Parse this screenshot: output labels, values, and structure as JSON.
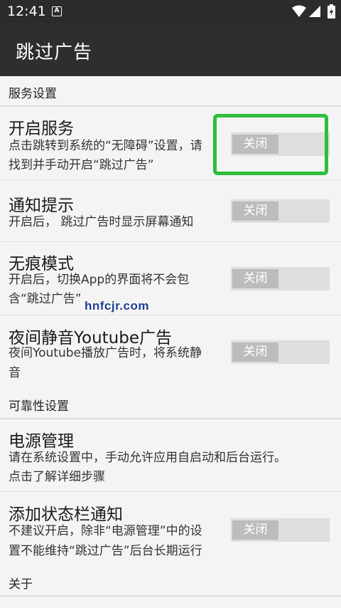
{
  "status_bar": {
    "time": "12:41",
    "notification_letter": "A"
  },
  "app_bar": {
    "title": "跳过广告"
  },
  "sections": {
    "service": "服务设置",
    "reliability": "可靠性设置",
    "about": "关于"
  },
  "items": {
    "start_service": {
      "title": "开启服务",
      "desc_line1": "点击跳转到系统的“无障碍”设置，请",
      "desc_line2": "找到并手动开启“跳过广告”",
      "toggle": "关闭"
    },
    "notification": {
      "title": "通知提示",
      "desc_line1": "开启后， 跳过广告时显示屏幕通知",
      "toggle": "关闭"
    },
    "stealth": {
      "title": "无痕模式",
      "desc_line1": "开启后，切换App的界面将不会包",
      "desc_line2": "含“跳过广告”",
      "toggle": "关闭"
    },
    "night_mute": {
      "title": "夜间静音Youtube广告",
      "desc_line1": "夜间Youtube播放广告时，将系统静",
      "desc_line2": "音",
      "toggle": "关闭"
    },
    "power": {
      "title": "电源管理",
      "desc_line1": "请在系统设置中，手动允许应用自启动和后台运行。",
      "desc_line2": "点击了解详细步骤"
    },
    "status_notif": {
      "title": "添加状态栏通知",
      "desc_line1": "不建议开启，除非“电源管理”中的设",
      "desc_line2": "置不能维持“跳过广告”后台长期运行",
      "toggle": "关闭"
    }
  },
  "watermark": "hnfcjr.com",
  "colors": {
    "highlight": "#2ebd3c",
    "app_bar": "#2e2e2e",
    "status_bar": "#2b2b2b"
  }
}
